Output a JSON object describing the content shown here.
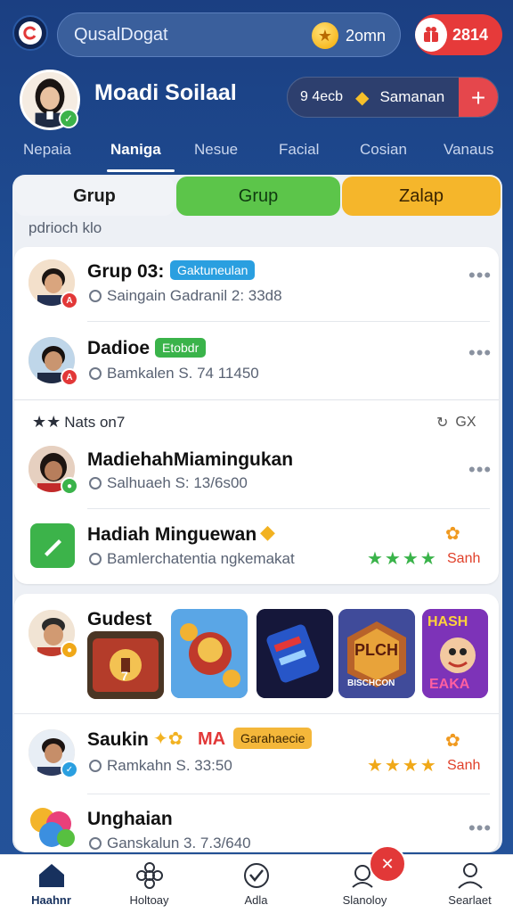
{
  "header": {
    "search_value": "QusalDogat",
    "coins": "2omn",
    "notifications": "2814"
  },
  "profile": {
    "name": "Moadi Soilaal",
    "balance_left": "9 4ecb",
    "balance_right": "Samanan"
  },
  "tabs": [
    {
      "label": "Nepaia",
      "active": false
    },
    {
      "label": "Naniga",
      "active": true
    },
    {
      "label": "Nesue",
      "active": false
    },
    {
      "label": "Facial",
      "active": false
    },
    {
      "label": "Cosian",
      "active": false
    },
    {
      "label": "Vanaus",
      "active": false
    }
  ],
  "segments": [
    "Grup",
    "Grup",
    "Zalap"
  ],
  "section_label": "pdrioch klo",
  "list": [
    {
      "title": "Grup 03:",
      "tag": "Gaktuneulan",
      "subtitle": "Saingain Gadranil 2: 33d8"
    },
    {
      "title": "Dadioe",
      "tag": "Etobdr",
      "subtitle": "Bamkalen S. 74 11450"
    }
  ],
  "subheader": {
    "label": "Nats on7",
    "right": "GX"
  },
  "list2": [
    {
      "title": "MadiehahMiamingukan",
      "subtitle": "Salhuaeh S: 13/6s00"
    },
    {
      "title": "Hadiah Minguewan",
      "subtitle": "Bamlerchatentia ngkemakat",
      "side": "Sanh"
    }
  ],
  "games_title": "Gudest",
  "games": [
    {
      "name": "game-tile-1",
      "caption": "7"
    },
    {
      "name": "game-tile-2",
      "caption": ""
    },
    {
      "name": "game-tile-3",
      "caption": ""
    },
    {
      "name": "game-tile-4",
      "caption": "PLCH"
    },
    {
      "name": "game-tile-5",
      "caption": "HASH"
    }
  ],
  "game4_sub": "BISCHCON",
  "game5_sub": "EAKA",
  "list3": [
    {
      "title": "Saukin",
      "badge_text": "MA",
      "tag": "Garahaecie",
      "subtitle": "Ramkahn S. 33:50",
      "side": "Sanh"
    },
    {
      "title": "Unghaian",
      "subtitle": "Ganskalun 3. 7.3/640"
    }
  ],
  "nav": [
    {
      "label": "Haahnr",
      "icon": "home-icon",
      "active": true
    },
    {
      "label": "Holtoay",
      "icon": "flower-icon",
      "active": false
    },
    {
      "label": "Adla",
      "icon": "check-circle-icon",
      "active": false
    },
    {
      "label": "Slanoloy",
      "icon": "chat-user-icon",
      "active": false
    },
    {
      "label": "Searlaet",
      "icon": "user-icon",
      "active": false
    }
  ],
  "colors": {
    "background": "#1e4b8f",
    "green": "#5cc54a",
    "yellow": "#f5b62b",
    "red": "#e23838",
    "tag_blue": "#2a9fe0",
    "tag_green": "#3ab34a",
    "tag_orange": "#f4b73a"
  }
}
